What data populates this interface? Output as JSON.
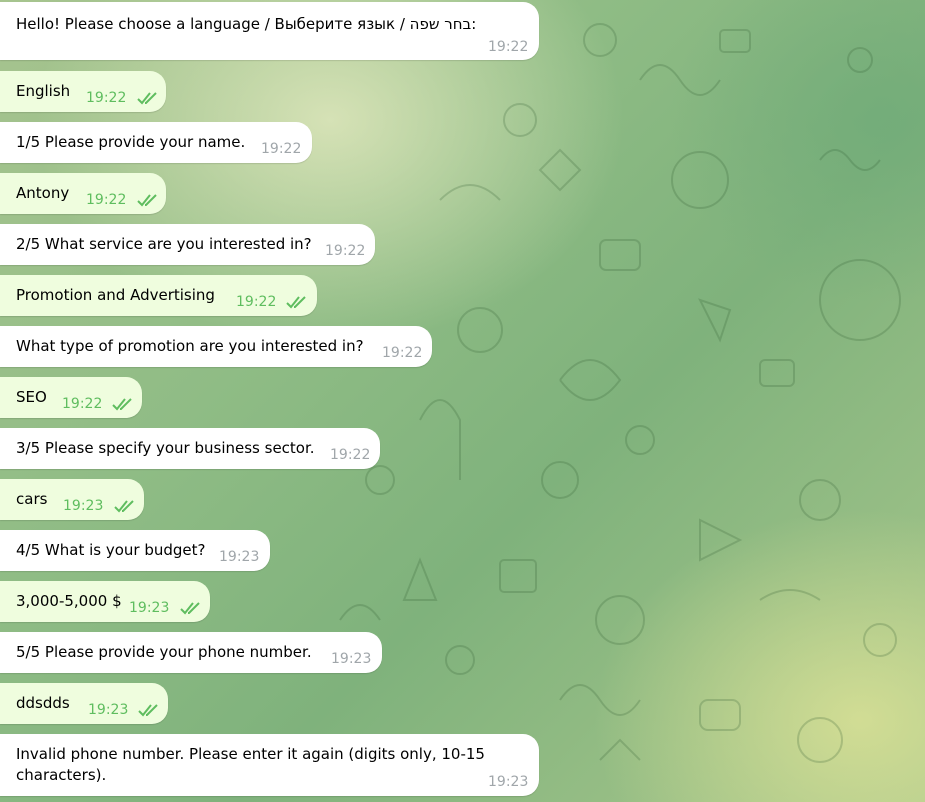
{
  "messages": [
    {
      "dir": "in",
      "text": "Hello! Please choose a language / Выберите язык / בחר שפה:",
      "time": "19:22"
    },
    {
      "dir": "out",
      "text": "English",
      "time": "19:22",
      "status": "read-ticks-icon"
    },
    {
      "dir": "in",
      "text": "1/5 Please provide your name.",
      "time": "19:22"
    },
    {
      "dir": "out",
      "text": "Antony",
      "time": "19:22",
      "status": "read-ticks-icon"
    },
    {
      "dir": "in",
      "text": "2/5 What service are you interested in?",
      "time": "19:22"
    },
    {
      "dir": "out",
      "text": "Promotion and Advertising",
      "time": "19:22",
      "status": "read-ticks-icon"
    },
    {
      "dir": "in",
      "text": "What type of promotion are you interested in?",
      "time": "19:22"
    },
    {
      "dir": "out",
      "text": "SEO",
      "time": "19:22",
      "status": "read-ticks-icon"
    },
    {
      "dir": "in",
      "text": "3/5 Please specify your business sector.",
      "time": "19:22"
    },
    {
      "dir": "out",
      "text": "cars",
      "time": "19:23",
      "status": "read-ticks-icon"
    },
    {
      "dir": "in",
      "text": "4/5 What is your budget?",
      "time": "19:23"
    },
    {
      "dir": "out",
      "text": "3,000-5,000 $",
      "time": "19:23",
      "status": "read-ticks-icon"
    },
    {
      "dir": "in",
      "text": "5/5 Please provide your phone number.",
      "time": "19:23"
    },
    {
      "dir": "out",
      "text": "ddsdds",
      "time": "19:23",
      "status": "read-ticks-icon"
    },
    {
      "dir": "in",
      "text_line1": "Invalid phone number. Please enter it again (digits only, 10-15",
      "text_line2": "characters).",
      "time": "19:23"
    }
  ],
  "colors": {
    "incoming_bubble": "#ffffff",
    "outgoing_bubble": "#effdde",
    "tick": "#5fbd5f",
    "time": "#a0a6aa"
  }
}
